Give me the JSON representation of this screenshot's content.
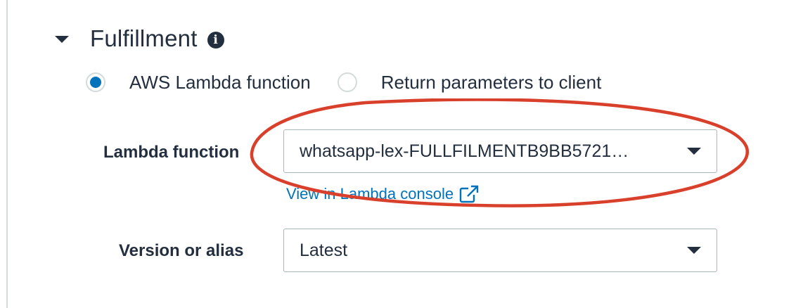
{
  "section": {
    "title": "Fulfillment",
    "info_icon": "info-icon",
    "caret_icon": "caret-down-icon"
  },
  "fulfillment_options": [
    {
      "label": "AWS Lambda function",
      "checked": true
    },
    {
      "label": "Return parameters to client",
      "checked": false
    }
  ],
  "lambda_function": {
    "label": "Lambda function",
    "value": "whatsapp-lex-FULLFILMENTB9BB5721…",
    "link_label": "View in Lambda console",
    "link_icon": "external-link-icon"
  },
  "version_alias": {
    "label": "Version or alias",
    "value": "Latest"
  },
  "colors": {
    "accent": "#0073bb",
    "text": "#232f3e",
    "annotation": "#d9402c",
    "border": "#aab7b8"
  }
}
